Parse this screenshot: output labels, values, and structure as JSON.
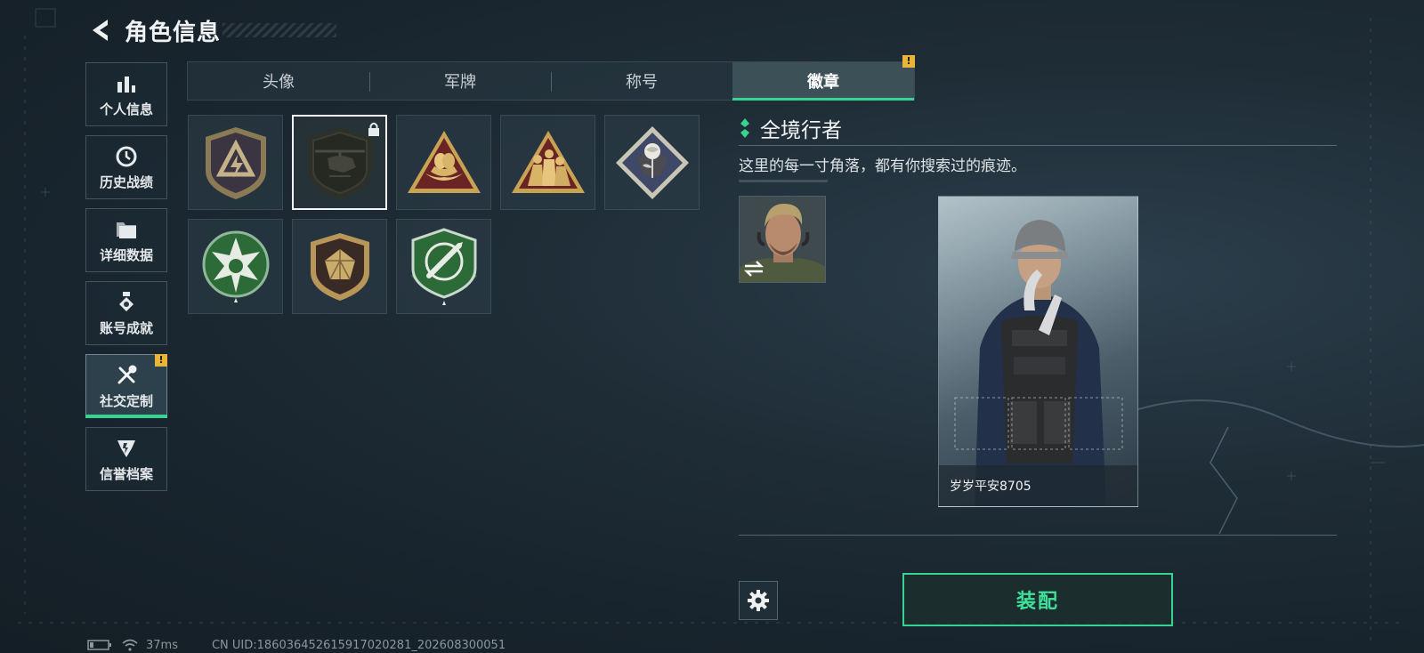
{
  "header": {
    "title": "角色信息"
  },
  "sidebar": {
    "items": [
      {
        "label": "个人信息",
        "icon": "bar-chart-icon",
        "active": false
      },
      {
        "label": "历史战绩",
        "icon": "history-clock-icon",
        "active": false
      },
      {
        "label": "详细数据",
        "icon": "folder-icon",
        "active": false
      },
      {
        "label": "账号成就",
        "icon": "achievement-icon",
        "active": false
      },
      {
        "label": "社交定制",
        "icon": "wrench-tools-icon",
        "active": true,
        "alert": "!"
      },
      {
        "label": "信誉档案",
        "icon": "credit-shield-icon",
        "active": false
      }
    ]
  },
  "tabs": [
    {
      "label": "头像",
      "active": false
    },
    {
      "label": "军牌",
      "active": false
    },
    {
      "label": "称号",
      "active": false
    },
    {
      "label": "徽章",
      "active": true,
      "alert": "!"
    }
  ],
  "badges": [
    {
      "name": "lightning-shield-badge",
      "selected": false,
      "locked": false
    },
    {
      "name": "helicopter-badge",
      "selected": true,
      "locked": true
    },
    {
      "name": "nest-triangle-badge",
      "selected": false,
      "locked": false
    },
    {
      "name": "squad-triangle-badge",
      "selected": false,
      "locked": false
    },
    {
      "name": "rose-diamond-badge",
      "selected": false,
      "locked": false
    },
    {
      "name": "green-star-badge",
      "selected": false,
      "locked": false
    },
    {
      "name": "gem-shield-badge",
      "selected": false,
      "locked": false
    },
    {
      "name": "green-crosshair-badge",
      "selected": false,
      "locked": false
    }
  ],
  "detail": {
    "title": "全境行者",
    "description": "这里的每一寸角落，都有你搜索过的痕迹。"
  },
  "card": {
    "player_name": "岁岁平安8705"
  },
  "actions": {
    "equip_label": "装配"
  },
  "status": {
    "ping": "37ms",
    "uid": "CN UID:18603645261591702028​1_202608300051"
  },
  "colors": {
    "accent": "#39d391",
    "alert": "#e8b53a",
    "background": "#1b2831"
  }
}
